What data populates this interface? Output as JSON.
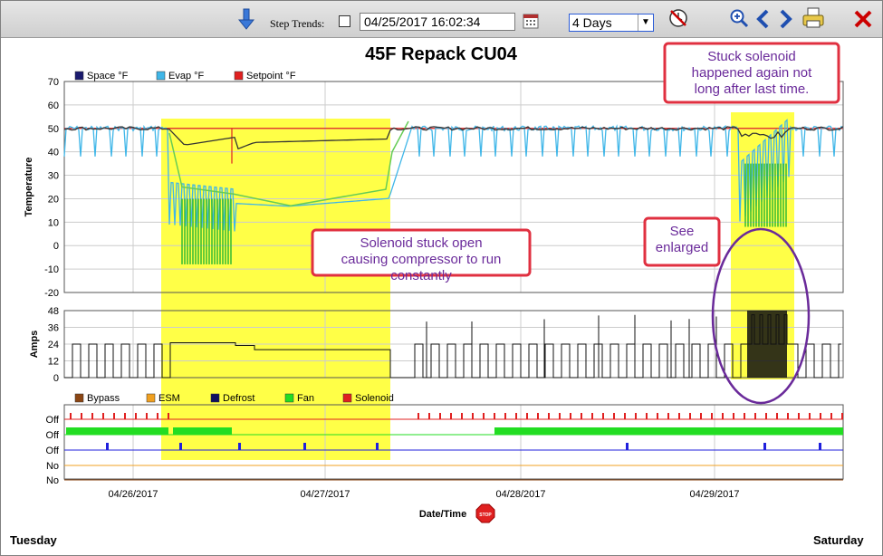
{
  "toolbar": {
    "step_trends_label": "Step Trends:",
    "date_value": "04/25/2017 16:02:34",
    "range_value": "4 Days",
    "icons": [
      "download-arrow-icon",
      "calendar-icon",
      "clock-stop-icon",
      "zoom-in-icon",
      "prev-icon",
      "next-icon",
      "print-icon",
      "close-icon"
    ],
    "close_color": "#cc0000",
    "nav_color": "#1f4fb0"
  },
  "footer": {
    "left_day": "Tuesday",
    "right_day": "Saturday"
  },
  "chart_data": {
    "type": "line",
    "title": "45F Repack CU04",
    "xlabel": "Date/Time",
    "x_ticks": [
      "04/26/2017",
      "04/27/2017",
      "04/28/2017",
      "04/29/2017"
    ],
    "temperature": {
      "ylabel": "Temperature",
      "ylim": [
        -20,
        70
      ],
      "y_ticks": [
        70,
        60,
        50,
        40,
        30,
        20,
        10,
        0,
        -10,
        -20
      ],
      "legend": [
        {
          "name": "Space °F",
          "color": "#1a1a6e"
        },
        {
          "name": "Evap °F",
          "color": "#3fb6e8"
        },
        {
          "name": "Setpoint °F",
          "color": "#e02020"
        }
      ],
      "setpoint": 50,
      "space_normal": 50,
      "evap_normal_high": 51,
      "evap_normal_low": 38
    },
    "amps": {
      "ylabel": "Amps",
      "ylim": [
        0,
        48
      ],
      "y_ticks": [
        48,
        36,
        24,
        12,
        0
      ]
    },
    "digital": {
      "legend": [
        {
          "name": "Bypass",
          "color": "#8b4513"
        },
        {
          "name": "ESM",
          "color": "#f0a020"
        },
        {
          "name": "Defrost",
          "color": "#101060"
        },
        {
          "name": "Fan",
          "color": "#22dd22"
        },
        {
          "name": "Solenoid",
          "color": "#e02020"
        }
      ],
      "row_labels": [
        "Off",
        "Off",
        "Off",
        "No",
        "No"
      ]
    },
    "annotations": [
      "Solenoid stuck open causing compressor to run  constantly",
      "Stuck solenoid happened again not long after last time.",
      "See enlarged"
    ],
    "stop_icon_text": "STOP"
  }
}
